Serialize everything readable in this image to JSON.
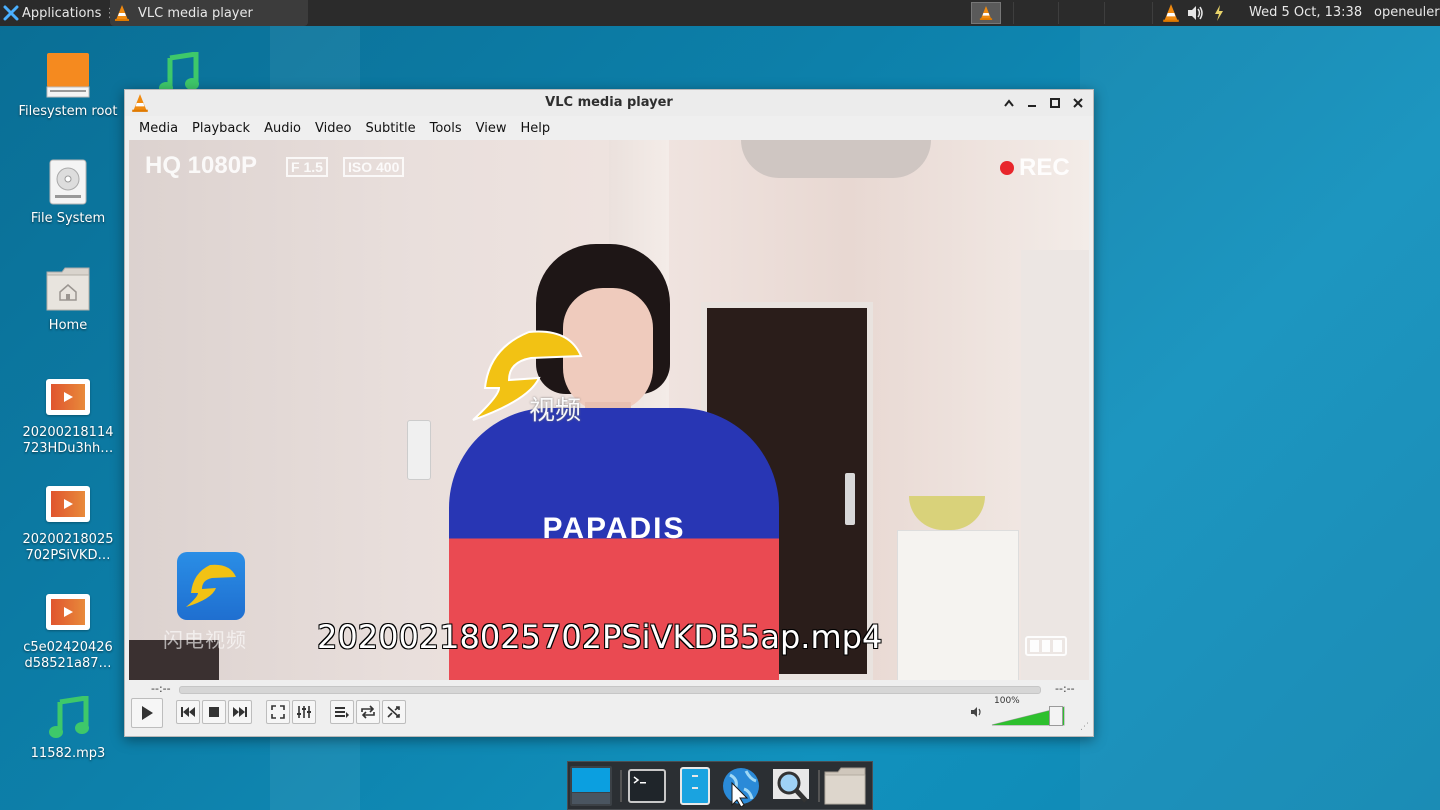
{
  "panel": {
    "apps_label": "Applications",
    "task_title": "VLC media player",
    "clock": "Wed  5 Oct, 13:38",
    "user": "openeuler"
  },
  "desktop": {
    "icons": [
      {
        "label": "Filesystem root",
        "icon": "drive-icon"
      },
      {
        "label": "File System",
        "icon": "harddisk-icon"
      },
      {
        "label": "Home",
        "icon": "home-folder-icon"
      },
      {
        "label": "20200218114 723HDu3hh…",
        "icon": "video-file-icon"
      },
      {
        "label": "20200218025 702PSiVKD…",
        "icon": "video-file-icon"
      },
      {
        "label": "c5e02420426 d58521a87…",
        "icon": "video-file-icon"
      },
      {
        "label": "11582.mp3",
        "icon": "music-note-icon"
      }
    ]
  },
  "vlc": {
    "title": "VLC media player",
    "menu": [
      "Media",
      "Playback",
      "Audio",
      "Video",
      "Subtitle",
      "Tools",
      "View",
      "Help"
    ],
    "video": {
      "osd_filename": "20200218025702PSiVKDB5ap.mp4",
      "hud_left": "HQ 1080P",
      "hud_f": "F 1.5",
      "hud_iso": "ISO 400",
      "rec": "REC",
      "shirt_text": "PAPADIS",
      "logo_text": "闪电视频",
      "logo_overlay_text": "视频"
    },
    "time_elapsed": "--:--",
    "time_total": "--:--",
    "volume": "100%",
    "volume_level": 1.0
  },
  "colors": {
    "desktop_bg": "#0d80aa",
    "panel_bg": "#2b2b2b",
    "volume_green": "#2ec02e",
    "rec_red": "#e8262b"
  }
}
